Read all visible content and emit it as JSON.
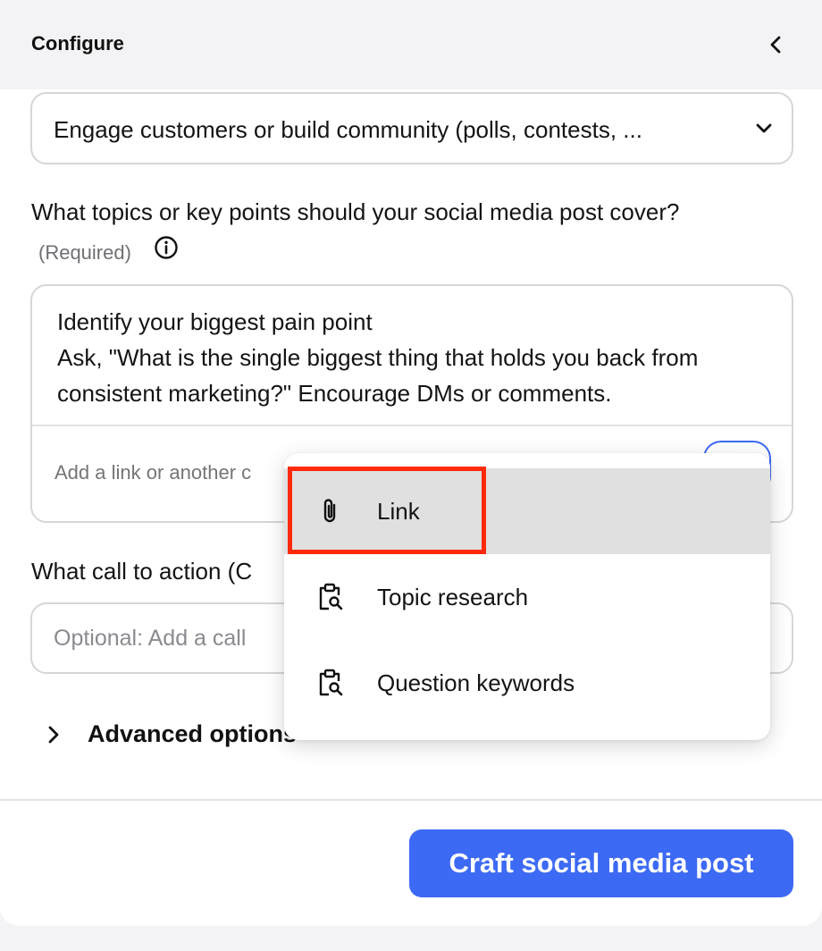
{
  "header": {
    "title": "Configure",
    "collapse_icon": "chevron-left-icon"
  },
  "goal_select": {
    "value": "Engage customers or build community (polls, contests, ..."
  },
  "topics": {
    "question": "What topics or key points should your social media post cover?",
    "required": "(Required)",
    "line1": "Identify your biggest pain point",
    "line2": "Ask, \"What is the single biggest thing that holds you back from consistent marketing?\" Encourage DMs or comments.",
    "add_placeholder": "Add a link or another c"
  },
  "cta": {
    "label": "What call to action (C",
    "placeholder": "Optional: Add a call"
  },
  "advanced": {
    "label": "Advanced options"
  },
  "submit": {
    "label": "Craft social media post"
  },
  "dropdown": {
    "items": [
      {
        "label": "Link",
        "icon": "paperclip-icon"
      },
      {
        "label": "Topic research",
        "icon": "clipboard-search-icon"
      },
      {
        "label": "Question keywords",
        "icon": "clipboard-search-icon"
      }
    ]
  },
  "colors": {
    "accent": "#3d6af4",
    "highlight": "#ff2a0a"
  }
}
